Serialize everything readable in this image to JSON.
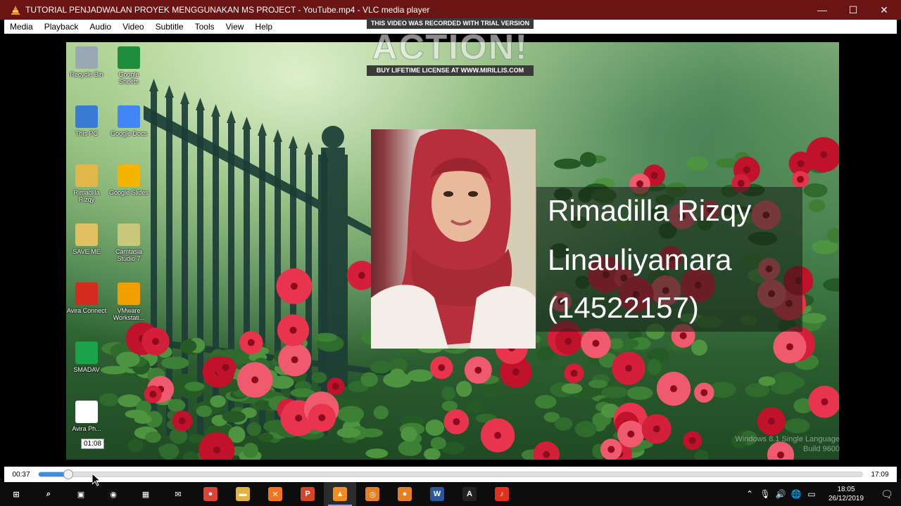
{
  "window": {
    "title": "TUTORIAL PENJADWALAN PROYEK MENGGUNAKAN MS PROJECT - YouTube.mp4 - VLC media player",
    "minimize_glyph": "—",
    "maximize_glyph": "☐",
    "close_glyph": "✕"
  },
  "menu": [
    "Media",
    "Playback",
    "Audio",
    "Video",
    "Subtitle",
    "Tools",
    "View",
    "Help"
  ],
  "watermark": {
    "top": "THIS VIDEO WAS RECORDED WITH TRIAL VERSION",
    "logo": "ACTION!",
    "bottom": "BUY LIFETIME LICENSE AT WWW.MIRILLIS.COM"
  },
  "desktop_icons": [
    {
      "label": "Recycle Bin",
      "icon": "recycle-bin-icon",
      "color": "#9aa7b4"
    },
    {
      "label": "Google Sheets",
      "icon": "google-sheets-icon",
      "color": "#1e8e3e"
    },
    {
      "label": "This PC",
      "icon": "this-pc-icon",
      "color": "#3a7bd5"
    },
    {
      "label": "Google Docs",
      "icon": "google-docs-icon",
      "color": "#4285f4"
    },
    {
      "label": "Rimadilla Rizqy",
      "icon": "folder-icon",
      "color": "#e0b84a"
    },
    {
      "label": "Google Slides",
      "icon": "google-slides-icon",
      "color": "#f4b400"
    },
    {
      "label": "SAVE ME",
      "icon": "folder-icon",
      "color": "#e0c060"
    },
    {
      "label": "Camtasia Studio 7",
      "icon": "camtasia-icon",
      "color": "#c9c77a"
    },
    {
      "label": "Avira Connect",
      "icon": "avira-icon",
      "color": "#d52b1e"
    },
    {
      "label": "VMware Workstati...",
      "icon": "vmware-icon",
      "color": "#f1a000"
    },
    {
      "label": "SMADAV",
      "icon": "smadav-icon",
      "color": "#1aa34a"
    },
    {
      "label": "Avira Ph...",
      "icon": "avira-phantom-icon",
      "color": "#ffffff"
    }
  ],
  "person": {
    "line1": "Rimadilla Rizqy",
    "line2": "Linauliyamara",
    "line3": "(14522157)"
  },
  "windows_watermark": {
    "line1": "Windows 8.1 Single Language",
    "line2": "Build 9600"
  },
  "tooltip": "01:08",
  "seek": {
    "elapsed": "00:37",
    "total": "17:09",
    "progress": 0.036
  },
  "taskbar": {
    "time": "18:05",
    "date": "26/12/2019",
    "apps": [
      {
        "name": "start-button",
        "icon": "windows-icon",
        "glyph": "⊞",
        "color": "#0d0d0d"
      },
      {
        "name": "search-button",
        "icon": "search-icon",
        "glyph": "⌕",
        "color": "#0d0d0d"
      },
      {
        "name": "task-view-button",
        "icon": "task-view-icon",
        "glyph": "▣",
        "color": "#0d0d0d"
      },
      {
        "name": "camera-app",
        "icon": "camera-icon",
        "glyph": "◉",
        "color": "#0d0d0d"
      },
      {
        "name": "store-app",
        "icon": "store-icon",
        "glyph": "▦",
        "color": "#0d0d0d"
      },
      {
        "name": "mail-app",
        "icon": "mail-icon",
        "glyph": "✉",
        "color": "#0d0d0d"
      },
      {
        "name": "chrome-app",
        "icon": "chrome-icon",
        "glyph": "●",
        "color": "#db4437"
      },
      {
        "name": "explorer-app",
        "icon": "folder-icon",
        "glyph": "▬",
        "color": "#e3b341"
      },
      {
        "name": "xampp-app",
        "icon": "xampp-icon",
        "glyph": "✕",
        "color": "#f2741f"
      },
      {
        "name": "powerpoint-app",
        "icon": "powerpoint-icon",
        "glyph": "P",
        "color": "#d24726"
      },
      {
        "name": "vlc-app",
        "icon": "vlc-icon",
        "glyph": "▲",
        "color": "#f68b1f"
      },
      {
        "name": "app-orange-1",
        "icon": "screen-recorder-icon",
        "glyph": "◎",
        "color": "#e67e22"
      },
      {
        "name": "app-orange-2",
        "icon": "action-recorder-icon",
        "glyph": "●",
        "color": "#e67e22"
      },
      {
        "name": "word-app",
        "icon": "word-icon",
        "glyph": "W",
        "color": "#2b579a"
      },
      {
        "name": "action-app",
        "icon": "action-icon",
        "glyph": "A",
        "color": "#222222"
      },
      {
        "name": "acrobat-app",
        "icon": "acrobat-icon",
        "glyph": "♪",
        "color": "#e0301e"
      }
    ],
    "active_app": "vlc-app"
  }
}
